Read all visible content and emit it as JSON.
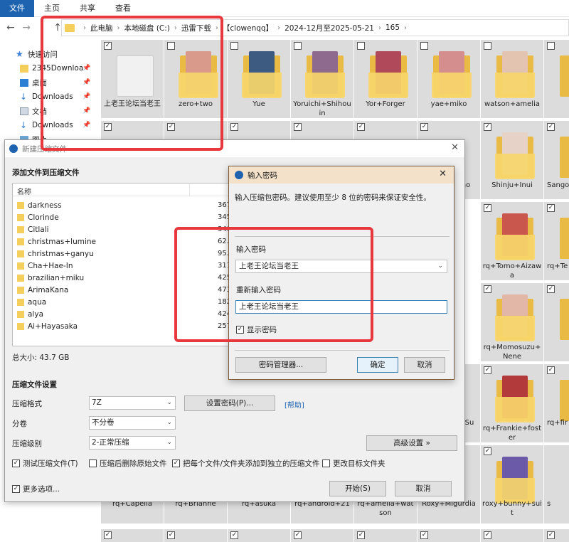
{
  "ribbon": {
    "tabs": [
      "文件",
      "主页",
      "共享",
      "查看"
    ]
  },
  "addressbar": {
    "path": [
      "此电脑",
      "本地磁盘 (C:)",
      "迅雷下载",
      "【clowenqq】",
      "2024-12月至2025-05-21",
      "165"
    ]
  },
  "navpane": {
    "items": [
      {
        "label": "快速访问",
        "icon": "star-icon"
      },
      {
        "label": "2345Downloads",
        "icon": "folder-icon"
      },
      {
        "label": "桌面",
        "icon": "desktop-icon"
      },
      {
        "label": "Downloads",
        "icon": "download-icon"
      },
      {
        "label": "文档",
        "icon": "document-icon"
      },
      {
        "label": "Downloads",
        "icon": "download-icon"
      },
      {
        "label": "图片",
        "icon": "picture-icon"
      }
    ]
  },
  "folders": {
    "row1": [
      "上老王论坛当老王",
      "zero+two",
      "Yue",
      "Yoruichi+Shihouin",
      "Yor+Forger",
      "yae+miko",
      "watson+amelia",
      ""
    ],
    "col_right": [
      "no",
      "Shinju+Inui",
      "Sango"
    ],
    "col_r2": [
      "rq+Momosuzu+Nene",
      "rq+Frankie+foster",
      "roxy+bunny+suit"
    ],
    "col_r1": [
      "rq+Tomo+Aizawa",
      "rq+Te",
      "rq+fir"
    ],
    "bottom": [
      "rq+Capella",
      "rq+Brianne",
      "rq+asuka",
      "rq+android+21",
      "rq+amelia+watson",
      "Roxy+Migurdia"
    ],
    "partial": [
      "Su",
      "s"
    ]
  },
  "compress_dialog": {
    "title": "新建压缩文件",
    "section_files": "添加文件到压缩文件",
    "list_header": "名称",
    "files": [
      {
        "name": "darkness",
        "size": "367"
      },
      {
        "name": "Clorinde",
        "size": "345"
      },
      {
        "name": "Citlali",
        "size": "340"
      },
      {
        "name": "christmas+lumine",
        "size": "62.4"
      },
      {
        "name": "christmas+ganyu",
        "size": "95.2"
      },
      {
        "name": "Cha+Hae-In",
        "size": "311"
      },
      {
        "name": "brazilian+miku",
        "size": "425"
      },
      {
        "name": "ArimaKana",
        "size": "473"
      },
      {
        "name": "aqua",
        "size": "182"
      },
      {
        "name": "alya",
        "size": "424"
      },
      {
        "name": "Ai+Hayasaka",
        "size": "257"
      }
    ],
    "total": "总大小: 43.7 GB",
    "section_settings": "压缩文件设置",
    "format_label": "压缩格式",
    "format_value": "7Z",
    "split_label": "分卷",
    "split_value": "不分卷",
    "level_label": "压缩级别",
    "level_value": "2-正常压缩",
    "set_password": "设置密码(P)...",
    "help": "[帮助]",
    "advanced": "高级设置 »",
    "checkboxes": [
      {
        "label": "测试压缩文件(T)",
        "checked": true
      },
      {
        "label": "压缩后删除原始文件",
        "checked": false
      },
      {
        "label": "把每个文件/文件夹添加到独立的压缩文件",
        "checked": true
      },
      {
        "label": "更改目标文件夹",
        "checked": false
      }
    ],
    "more_options": "更多选项...",
    "start": "开始(S)",
    "cancel": "取消"
  },
  "password_dialog": {
    "title": "输入密码",
    "hint": "输入压缩包密码。建议使用至少 8 位的密码来保证安全性。",
    "enter_label": "输入密码",
    "enter_value": "上老王论坛当老王",
    "reenter_label": "重新输入密码",
    "reenter_value": "上老王论坛当老王",
    "show_password": "显示密码",
    "manager": "密码管理器...",
    "ok": "确定",
    "cancel": "取消"
  },
  "colors": {
    "accent": "#1e63b0",
    "annotation": "#e8383d",
    "folder": "#f4cf5c"
  }
}
